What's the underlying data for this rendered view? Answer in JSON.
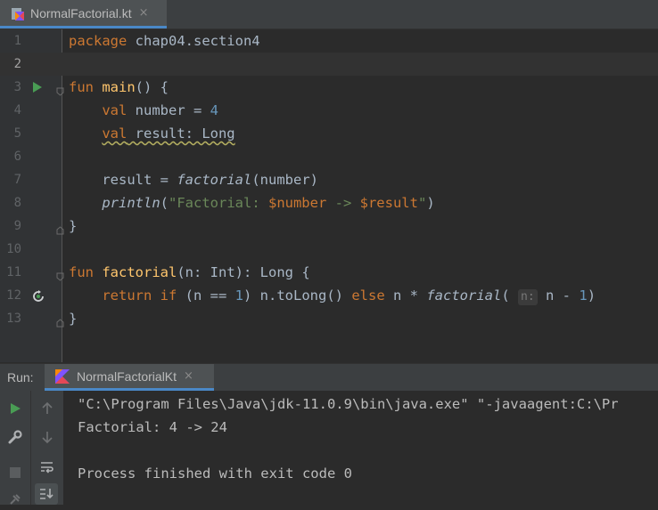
{
  "editor_tab": {
    "title": "NormalFactorial.kt",
    "close": "×"
  },
  "code": {
    "line_numbers": [
      "1",
      "2",
      "3",
      "4",
      "5",
      "6",
      "7",
      "8",
      "9",
      "10",
      "11",
      "12",
      "13"
    ],
    "l1": {
      "kw": "package",
      "rest": " chap04.section4"
    },
    "l3": {
      "kw": "fun",
      "sp": " ",
      "fn": "main",
      "rest": "() {"
    },
    "l4": {
      "indent": "    ",
      "kw": "val",
      "rest": " number = ",
      "num": "4"
    },
    "l5": {
      "indent": "    ",
      "kw": "val",
      "rest": " result: Long"
    },
    "l7": {
      "indent": "    ",
      "pre": "result = ",
      "fn": "factorial",
      "post": "(number)"
    },
    "l8": {
      "indent": "    ",
      "fn": "println",
      "open": "(",
      "s1": "\"Factorial: ",
      "v1": "$number",
      "s2": " -> ",
      "v2": "$result",
      "s3": "\"",
      "close": ")"
    },
    "l9": {
      "text": "}"
    },
    "l11": {
      "kw": "fun",
      "sp": " ",
      "fn": "factorial",
      "rest": "(n: Int): Long {"
    },
    "l12": {
      "indent": "    ",
      "kw1": "return",
      "sp1": " ",
      "kw2": "if",
      "a": " (n == ",
      "num1": "1",
      "b": ") n.toLong() ",
      "kw3": "else",
      "c": " n * ",
      "fn": "factorial",
      "d": "( ",
      "hint": "n:",
      "e": " n - ",
      "num2": "1",
      "f": ")"
    },
    "l13": {
      "text": "}"
    }
  },
  "run_panel": {
    "label": "Run:",
    "tab_title": "NormalFactorialKt",
    "tab_close": "×",
    "output": [
      "\"C:\\Program Files\\Java\\jdk-11.0.9\\bin\\java.exe\" \"-javaagent:C:\\Pr",
      "Factorial: 4 -> 24",
      "",
      "Process finished with exit code 0"
    ]
  },
  "icons": {
    "file_tab": "kotlin-file-icon",
    "run_tab": "kotlin-run-icon",
    "gutter_run": "run-gutter-icon",
    "gutter_recursion": "recursive-call-icon",
    "rerun": "rerun-icon",
    "settings": "wrench-icon",
    "stop": "stop-icon",
    "up": "up-arrow-icon",
    "down": "down-arrow-icon",
    "wrap": "soft-wrap-icon",
    "scroll": "scroll-to-end-icon"
  },
  "colors": {
    "keyword": "#cc7832",
    "function": "#ffc66d",
    "number": "#6897bb",
    "string": "#6a8759",
    "text": "#a9b7c6",
    "run_green": "#499c54",
    "tab_accent": "#4a88c7"
  }
}
